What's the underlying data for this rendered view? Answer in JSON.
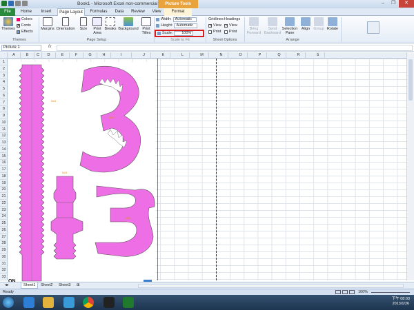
{
  "window": {
    "title": "Book1 - Microsoft Excel non-commercial use (Trial)",
    "context_tab": "Picture Tools",
    "buttons": [
      "–",
      "❐",
      "✕"
    ]
  },
  "tabs": [
    "File",
    "Home",
    "Insert",
    "Page Layout",
    "Formulas",
    "Data",
    "Review",
    "View",
    "Format"
  ],
  "ribbon": {
    "themes": {
      "label": "Themes",
      "colors": "Colors",
      "fonts": "Fonts",
      "effects": "Effects",
      "group": "Themes"
    },
    "page_setup": {
      "margins": "Margins",
      "orientation": "Orientation",
      "size": "Size",
      "print_area": "Print Area",
      "breaks": "Breaks",
      "background": "Background",
      "print_titles": "Print Titles",
      "group": "Page Setup"
    },
    "scale_to_fit": {
      "width_label": "Width:",
      "width_value": "Automatic",
      "height_label": "Height:",
      "height_value": "Automatic",
      "scale_label": "Scale:",
      "scale_value": "100%",
      "group": "Scale to Fit"
    },
    "sheet_options": {
      "gridlines": "Gridlines",
      "headings": "Headings",
      "view": "View",
      "print": "Print",
      "group": "Sheet Options"
    },
    "arrange": {
      "bring_forward": "Bring Forward",
      "send_backward": "Send Backward",
      "selection_pane": "Selection Pane",
      "align": "Align",
      "group_btn": "Group",
      "rotate": "Rotate",
      "group": "Arrange"
    }
  },
  "formula_bar": {
    "name_box": "Picture 1",
    "fx": "fx"
  },
  "columns": [
    "A",
    "B",
    "C",
    "D",
    "E",
    "F",
    "G",
    "H",
    "I",
    "J",
    "K",
    "L",
    "M",
    "N",
    "O",
    "P",
    "Q",
    "R",
    "S"
  ],
  "rows": [
    "1",
    "2",
    "3",
    "4",
    "5",
    "6",
    "7",
    "8",
    "9",
    "10",
    "11",
    "12",
    "13",
    "14",
    "15",
    "16",
    "17",
    "18",
    "19",
    "20",
    "21",
    "22",
    "23",
    "24",
    "25",
    "26",
    "27",
    "28",
    "29",
    "30",
    "31",
    "32",
    "33"
  ],
  "picture": {
    "labels": [
      "N04",
      "N01",
      "N03",
      "N02",
      "N03"
    ],
    "corner_text": "ON",
    "accent": "#ee6ee6"
  },
  "sheets": [
    "Sheet1",
    "Sheet2",
    "Sheet3"
  ],
  "status": {
    "left": "Ready",
    "zoom": "100%"
  },
  "taskbar": {
    "time": "下午 08:03",
    "date": "2013/1/26"
  }
}
